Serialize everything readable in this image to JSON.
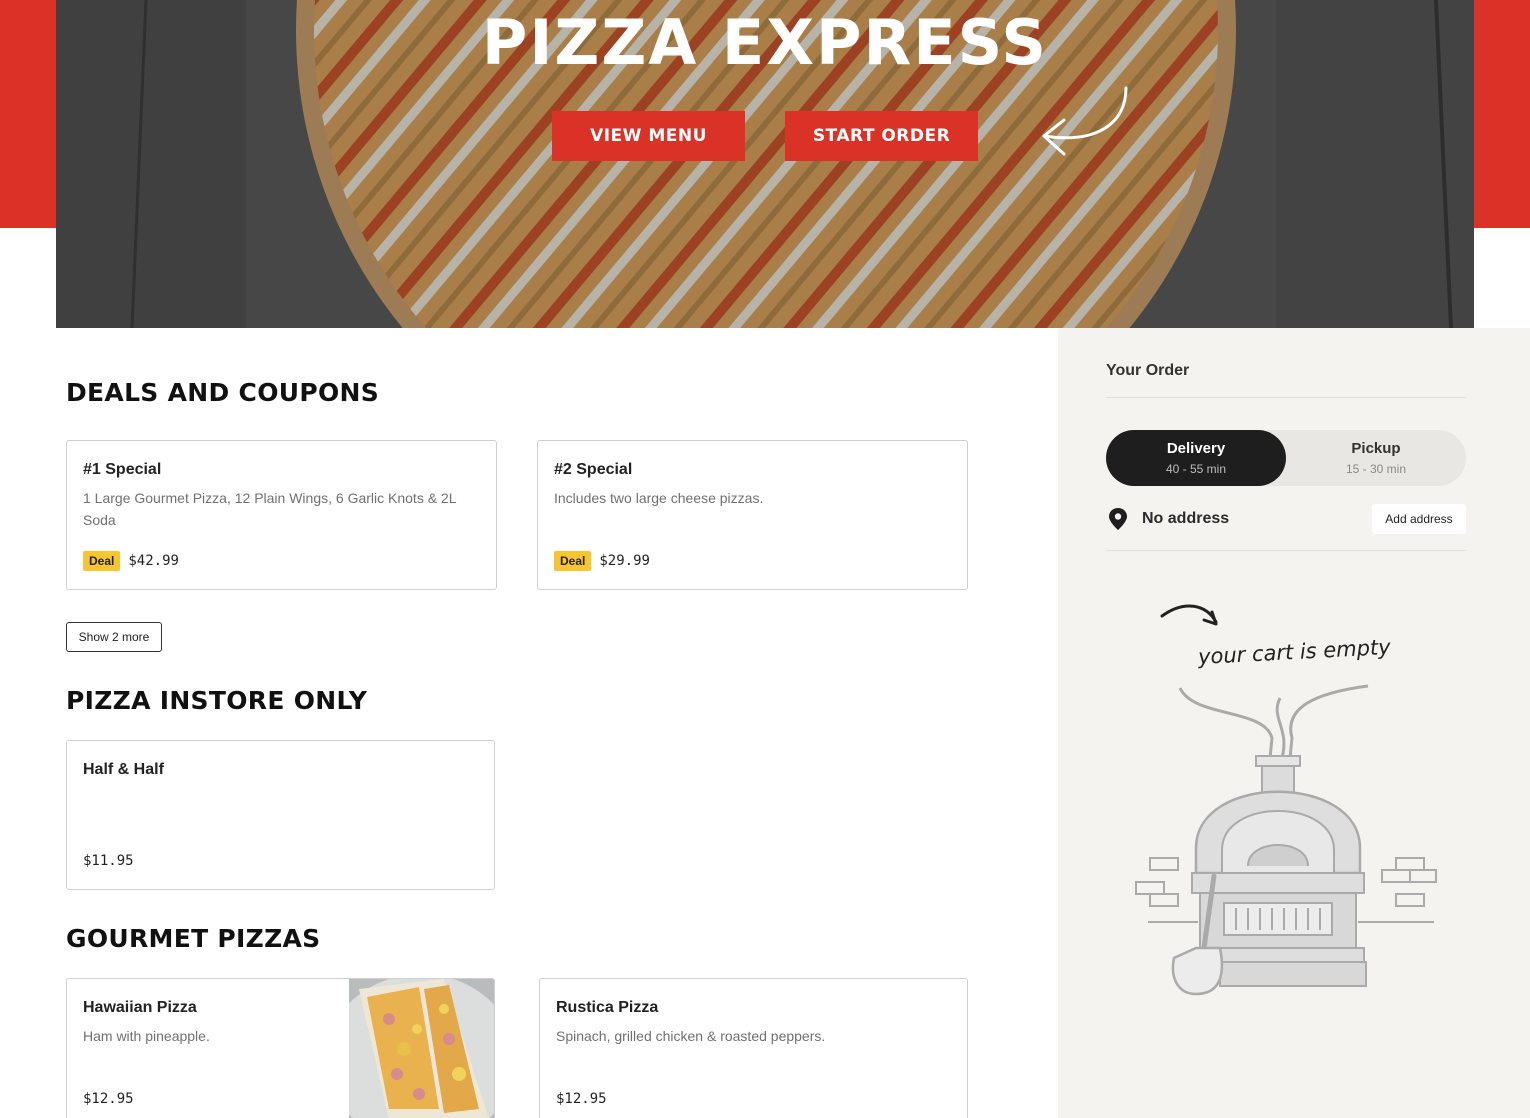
{
  "hero": {
    "title": "PIZZA EXPRESS",
    "view_menu_label": "VIEW MENU",
    "start_order_label": "START ORDER"
  },
  "colors": {
    "brand_red": "#db3227",
    "deal_yellow": "#f6c531",
    "sidebar_bg": "#f4f3f0",
    "toggle_active": "#1e1e1e"
  },
  "sections": {
    "deals": {
      "title": "DEALS AND COUPONS",
      "items": [
        {
          "name": "#1 Special",
          "description": "1 Large Gourmet Pizza, 12 Plain Wings, 6 Garlic Knots & 2L Soda",
          "badge": "Deal",
          "price": "$42.99"
        },
        {
          "name": "#2 Special",
          "description": "Includes two large cheese pizzas.",
          "badge": "Deal",
          "price": "$29.99"
        }
      ],
      "show_more_label": "Show 2 more"
    },
    "instore": {
      "title": "PIZZA INSTORE ONLY",
      "items": [
        {
          "name": "Half & Half",
          "price": "$11.95"
        }
      ]
    },
    "gourmet": {
      "title": "GOURMET PIZZAS",
      "items": [
        {
          "name": "Hawaiian Pizza",
          "description": "Ham with pineapple.",
          "price": "$12.95"
        },
        {
          "name": "Rustica Pizza",
          "description": "Spinach, grilled chicken & roasted peppers.",
          "price": "$12.95"
        }
      ]
    }
  },
  "order": {
    "heading": "Your Order",
    "modes": [
      {
        "label": "Delivery",
        "time": "40 - 55 min",
        "active": true
      },
      {
        "label": "Pickup",
        "time": "15 - 30 min",
        "active": false
      }
    ],
    "address_text": "No address",
    "add_address_label": "Add address",
    "empty_cart_text": "your cart is empty",
    "icons": [
      "location-pin-icon",
      "curved-arrow-icon",
      "pizza-oven-illustration"
    ]
  }
}
